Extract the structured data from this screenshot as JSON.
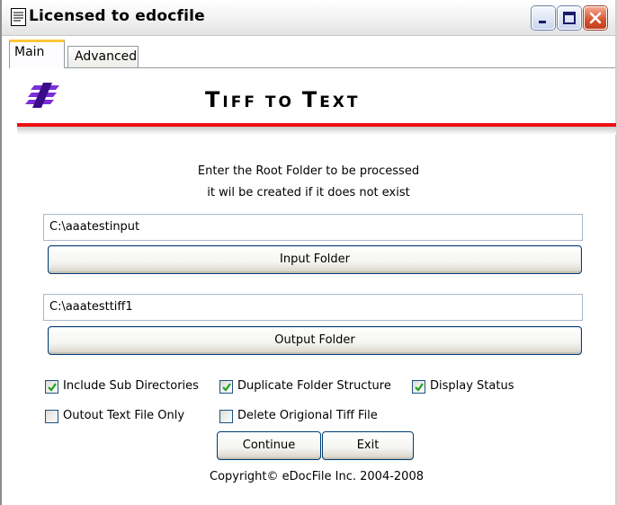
{
  "window": {
    "title": "Licensed to edocfile"
  },
  "tabs": [
    {
      "label": "Main"
    },
    {
      "label": "Advanced"
    }
  ],
  "header": {
    "title_initial": "T",
    "title_rest": "IFF TO ",
    "title_initial2": "T",
    "title_rest2": "EXT",
    "accent_color": "#ee0f12"
  },
  "instructions": {
    "line1": "Enter the Root Folder to be processed",
    "line2": "it wil be created if it does not exist"
  },
  "input": {
    "value": "C:\\aaatestinput",
    "button_label": "Input Folder"
  },
  "output": {
    "value": "C:\\aaatesttiff1",
    "button_label": "Output Folder"
  },
  "options": [
    {
      "label": "Include Sub Directories",
      "checked": true
    },
    {
      "label": "Duplicate Folder Structure",
      "checked": true
    },
    {
      "label": "Display Status",
      "checked": true
    },
    {
      "label": "Outout Text File Only",
      "checked": false
    },
    {
      "label": "Delete Origional Tiff File",
      "checked": false
    }
  ],
  "buttons": {
    "continue": "Continue",
    "exit": "Exit"
  },
  "footer": {
    "copyright": "Copyright© eDocFile Inc. 2004-2008"
  }
}
